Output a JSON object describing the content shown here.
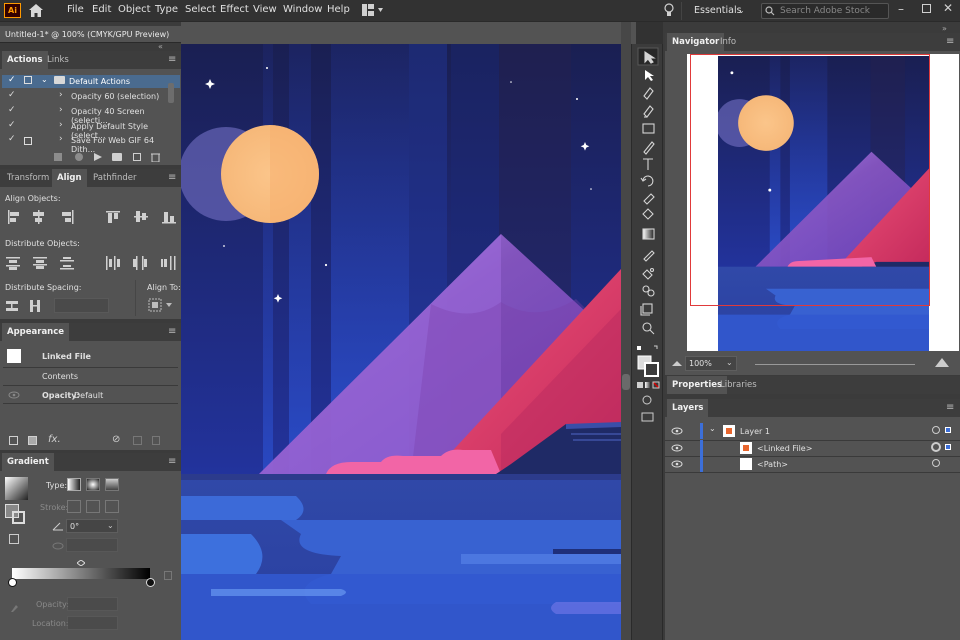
{
  "app": {
    "logo_text": "Ai"
  },
  "menu": [
    "File",
    "Edit",
    "Object",
    "Type",
    "Select",
    "Effect",
    "View",
    "Window",
    "Help"
  ],
  "workspace": {
    "label": "Essentials"
  },
  "search": {
    "placeholder": "Search Adobe Stock"
  },
  "document": {
    "tab_title": "Untitled-1* @ 100% (CMYK/GPU Preview)"
  },
  "actions_panel": {
    "tabs": [
      "Actions",
      "Links"
    ],
    "set_name": "Default Actions",
    "items": [
      "Opacity 60 (selection)",
      "Opacity 40 Screen (selecti...",
      "Apply Default Style (select...",
      "Save For Web GIF 64 Dith..."
    ]
  },
  "align_panel": {
    "tabs": [
      "Transform",
      "Align",
      "Pathfinder"
    ],
    "align_objects": "Align Objects:",
    "distribute_objects": "Distribute Objects:",
    "distribute_spacing": "Distribute Spacing:",
    "align_to": "Align To:"
  },
  "appearance_panel": {
    "tab": "Appearance",
    "linked_file": "Linked File",
    "contents": "Contents",
    "opacity_label": "Opacity:",
    "opacity_value": "Default",
    "fx": "fx."
  },
  "gradient_panel": {
    "tab": "Gradient",
    "type_label": "Type:",
    "stroke_label": "Stroke:",
    "angle_value": "0°",
    "opacity_label": "Opacity:",
    "location_label": "Location:"
  },
  "navigator_panel": {
    "tabs": [
      "Navigator",
      "Info"
    ],
    "zoom": "100%"
  },
  "properties_panel": {
    "tabs": [
      "Properties",
      "Libraries"
    ]
  },
  "layers_panel": {
    "tab": "Layers",
    "layers": [
      {
        "name": "Layer 1"
      },
      {
        "name": "<Linked File>"
      },
      {
        "name": "<Path>"
      }
    ]
  },
  "colors": {
    "accent": "#3f7fd4",
    "sky_dark": "#1a2258",
    "sky_blue": "#2336a6",
    "moon": "#fbc58a",
    "mountain_purple": "#9a5fc5",
    "mountain_pink": "#e0406f",
    "water": "#3a62d8",
    "layer_color": "#3c6fd9"
  }
}
